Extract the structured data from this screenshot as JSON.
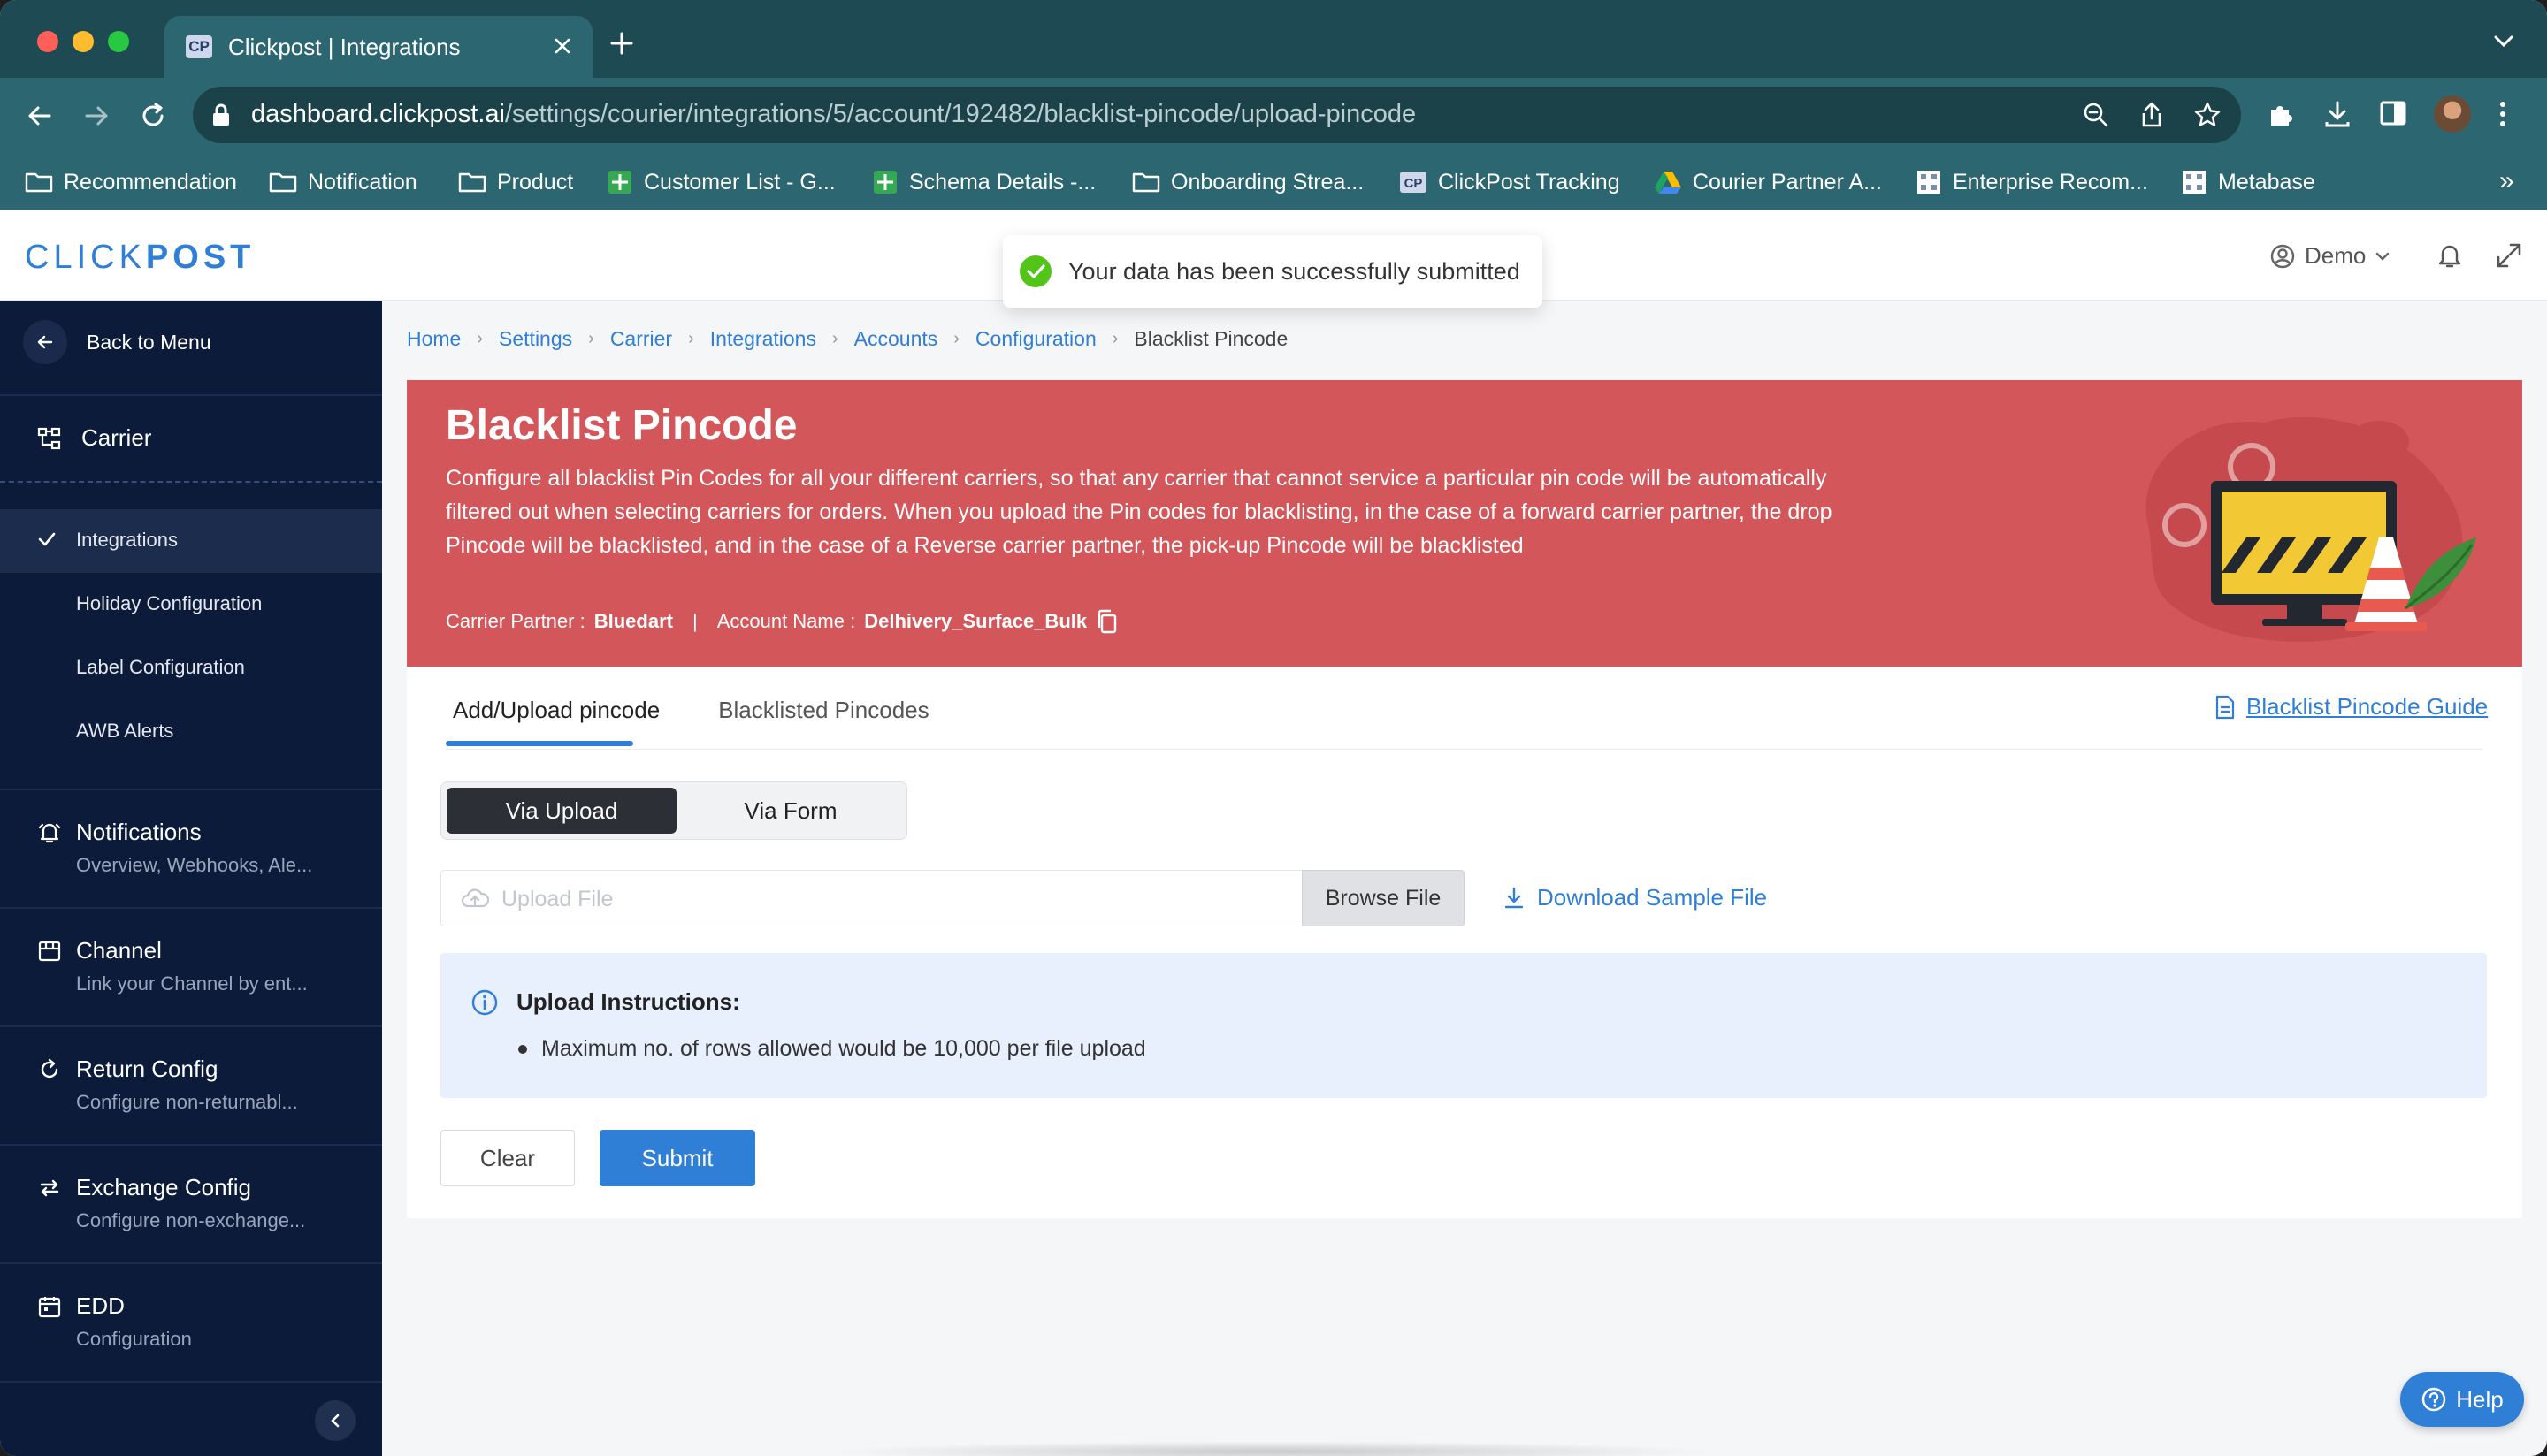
{
  "browser": {
    "tab_title": "Clickpost | Integrations",
    "tab_favicon": "CP",
    "url_host": "dashboard.clickpost.ai",
    "url_path": "/settings/courier/integrations/5/account/192482/blacklist-pincode/upload-pincode",
    "bookmarks": [
      {
        "icon": "folder-icon",
        "label": "Recommendation"
      },
      {
        "icon": "folder-icon",
        "label": "Notification"
      },
      {
        "icon": "folder-icon",
        "label": "Product"
      },
      {
        "icon": "sheets-icon",
        "label": "Customer List - G..."
      },
      {
        "icon": "sheets-icon",
        "label": "Schema Details -..."
      },
      {
        "icon": "folder-icon",
        "label": "Onboarding Strea..."
      },
      {
        "icon": "cp-icon",
        "label": "ClickPost Tracking"
      },
      {
        "icon": "drive-icon",
        "label": "Courier Partner A..."
      },
      {
        "icon": "grid-icon",
        "label": "Enterprise Recom..."
      },
      {
        "icon": "grid-icon",
        "label": "Metabase"
      }
    ],
    "bookmarks_more": "»"
  },
  "header": {
    "logo_light": "CLICK",
    "logo_bold": "POST",
    "user_label": "Demo"
  },
  "toast": {
    "message": "Your data has been successfully submitted"
  },
  "sidebar": {
    "back_label": "Back to Menu",
    "carrier_label": "Carrier",
    "sub_items": [
      "Integrations",
      "Holiday Configuration",
      "Label Configuration",
      "AWB Alerts"
    ],
    "groups": [
      {
        "title": "Notifications",
        "subtitle": "Overview, Webhooks, Ale..."
      },
      {
        "title": "Channel",
        "subtitle": "Link your Channel by ent..."
      },
      {
        "title": "Return Config",
        "subtitle": "Configure non-returnabl..."
      },
      {
        "title": "Exchange Config",
        "subtitle": "Configure non-exchange..."
      },
      {
        "title": "EDD",
        "subtitle": "Configuration"
      }
    ]
  },
  "breadcrumbs": [
    "Home",
    "Settings",
    "Carrier",
    "Integrations",
    "Accounts",
    "Configuration"
  ],
  "breadcrumb_current": "Blacklist Pincode",
  "banner": {
    "title": "Blacklist Pincode",
    "description": "Configure all blacklist Pin Codes for all your different carriers, so that any carrier that cannot service a particular pin code will be automatically filtered out when selecting carriers for orders. When you upload the Pin codes for blacklisting, in the case of a forward carrier partner, the drop Pincode will be blacklisted, and in the case of a Reverse carrier partner, the pick-up Pincode will be blacklisted",
    "carrier_partner_label": "Carrier Partner :",
    "carrier_partner_value": "Bluedart",
    "separator": "|",
    "account_name_label": "Account Name :",
    "account_name_value": "Delhivery_Surface_Bulk"
  },
  "tabs": {
    "active": "Add/Upload pincode",
    "inactive": "Blacklisted Pincodes",
    "guide_link": "Blacklist Pincode Guide"
  },
  "mode": {
    "upload": "Via Upload",
    "form": "Via Form"
  },
  "upload": {
    "placeholder": "Upload File",
    "browse_label": "Browse File",
    "download_label": "Download Sample File"
  },
  "instructions": {
    "title": "Upload Instructions:",
    "items": [
      "Maximum no. of rows allowed would be 10,000 per file upload"
    ]
  },
  "actions": {
    "clear": "Clear",
    "submit": "Submit"
  },
  "help_label": "Help",
  "colors": {
    "accent": "#2f7fd6",
    "banner": "#d3575a",
    "sidebar": "#0c1b3a",
    "chrome": "#2c6771",
    "success": "#52c41a"
  }
}
